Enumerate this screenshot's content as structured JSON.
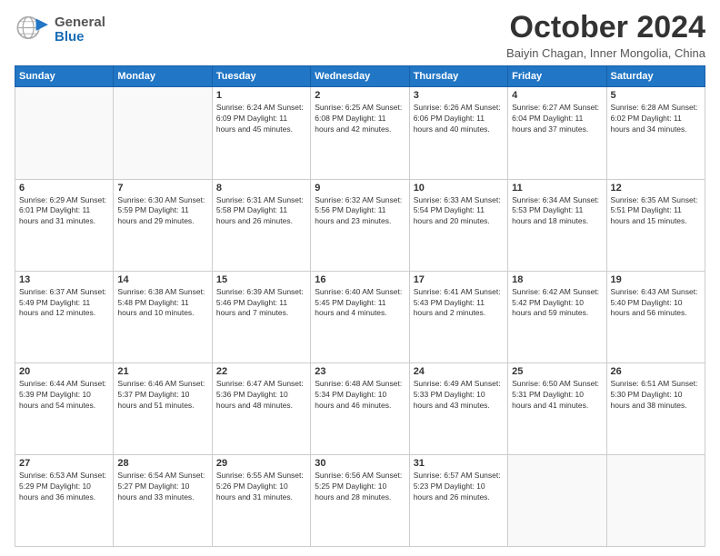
{
  "header": {
    "logo": {
      "general": "General",
      "blue": "Blue"
    },
    "title": "October 2024",
    "location": "Baiyin Chagan, Inner Mongolia, China"
  },
  "calendar": {
    "days_of_week": [
      "Sunday",
      "Monday",
      "Tuesday",
      "Wednesday",
      "Thursday",
      "Friday",
      "Saturday"
    ],
    "weeks": [
      [
        {
          "day": "",
          "info": ""
        },
        {
          "day": "",
          "info": ""
        },
        {
          "day": "1",
          "info": "Sunrise: 6:24 AM\nSunset: 6:09 PM\nDaylight: 11 hours and 45 minutes."
        },
        {
          "day": "2",
          "info": "Sunrise: 6:25 AM\nSunset: 6:08 PM\nDaylight: 11 hours and 42 minutes."
        },
        {
          "day": "3",
          "info": "Sunrise: 6:26 AM\nSunset: 6:06 PM\nDaylight: 11 hours and 40 minutes."
        },
        {
          "day": "4",
          "info": "Sunrise: 6:27 AM\nSunset: 6:04 PM\nDaylight: 11 hours and 37 minutes."
        },
        {
          "day": "5",
          "info": "Sunrise: 6:28 AM\nSunset: 6:02 PM\nDaylight: 11 hours and 34 minutes."
        }
      ],
      [
        {
          "day": "6",
          "info": "Sunrise: 6:29 AM\nSunset: 6:01 PM\nDaylight: 11 hours and 31 minutes."
        },
        {
          "day": "7",
          "info": "Sunrise: 6:30 AM\nSunset: 5:59 PM\nDaylight: 11 hours and 29 minutes."
        },
        {
          "day": "8",
          "info": "Sunrise: 6:31 AM\nSunset: 5:58 PM\nDaylight: 11 hours and 26 minutes."
        },
        {
          "day": "9",
          "info": "Sunrise: 6:32 AM\nSunset: 5:56 PM\nDaylight: 11 hours and 23 minutes."
        },
        {
          "day": "10",
          "info": "Sunrise: 6:33 AM\nSunset: 5:54 PM\nDaylight: 11 hours and 20 minutes."
        },
        {
          "day": "11",
          "info": "Sunrise: 6:34 AM\nSunset: 5:53 PM\nDaylight: 11 hours and 18 minutes."
        },
        {
          "day": "12",
          "info": "Sunrise: 6:35 AM\nSunset: 5:51 PM\nDaylight: 11 hours and 15 minutes."
        }
      ],
      [
        {
          "day": "13",
          "info": "Sunrise: 6:37 AM\nSunset: 5:49 PM\nDaylight: 11 hours and 12 minutes."
        },
        {
          "day": "14",
          "info": "Sunrise: 6:38 AM\nSunset: 5:48 PM\nDaylight: 11 hours and 10 minutes."
        },
        {
          "day": "15",
          "info": "Sunrise: 6:39 AM\nSunset: 5:46 PM\nDaylight: 11 hours and 7 minutes."
        },
        {
          "day": "16",
          "info": "Sunrise: 6:40 AM\nSunset: 5:45 PM\nDaylight: 11 hours and 4 minutes."
        },
        {
          "day": "17",
          "info": "Sunrise: 6:41 AM\nSunset: 5:43 PM\nDaylight: 11 hours and 2 minutes."
        },
        {
          "day": "18",
          "info": "Sunrise: 6:42 AM\nSunset: 5:42 PM\nDaylight: 10 hours and 59 minutes."
        },
        {
          "day": "19",
          "info": "Sunrise: 6:43 AM\nSunset: 5:40 PM\nDaylight: 10 hours and 56 minutes."
        }
      ],
      [
        {
          "day": "20",
          "info": "Sunrise: 6:44 AM\nSunset: 5:39 PM\nDaylight: 10 hours and 54 minutes."
        },
        {
          "day": "21",
          "info": "Sunrise: 6:46 AM\nSunset: 5:37 PM\nDaylight: 10 hours and 51 minutes."
        },
        {
          "day": "22",
          "info": "Sunrise: 6:47 AM\nSunset: 5:36 PM\nDaylight: 10 hours and 48 minutes."
        },
        {
          "day": "23",
          "info": "Sunrise: 6:48 AM\nSunset: 5:34 PM\nDaylight: 10 hours and 46 minutes."
        },
        {
          "day": "24",
          "info": "Sunrise: 6:49 AM\nSunset: 5:33 PM\nDaylight: 10 hours and 43 minutes."
        },
        {
          "day": "25",
          "info": "Sunrise: 6:50 AM\nSunset: 5:31 PM\nDaylight: 10 hours and 41 minutes."
        },
        {
          "day": "26",
          "info": "Sunrise: 6:51 AM\nSunset: 5:30 PM\nDaylight: 10 hours and 38 minutes."
        }
      ],
      [
        {
          "day": "27",
          "info": "Sunrise: 6:53 AM\nSunset: 5:29 PM\nDaylight: 10 hours and 36 minutes."
        },
        {
          "day": "28",
          "info": "Sunrise: 6:54 AM\nSunset: 5:27 PM\nDaylight: 10 hours and 33 minutes."
        },
        {
          "day": "29",
          "info": "Sunrise: 6:55 AM\nSunset: 5:26 PM\nDaylight: 10 hours and 31 minutes."
        },
        {
          "day": "30",
          "info": "Sunrise: 6:56 AM\nSunset: 5:25 PM\nDaylight: 10 hours and 28 minutes."
        },
        {
          "day": "31",
          "info": "Sunrise: 6:57 AM\nSunset: 5:23 PM\nDaylight: 10 hours and 26 minutes."
        },
        {
          "day": "",
          "info": ""
        },
        {
          "day": "",
          "info": ""
        }
      ]
    ]
  }
}
